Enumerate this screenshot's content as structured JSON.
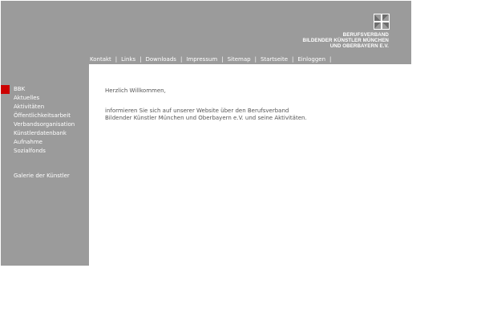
{
  "header": {
    "org_lines": [
      "BERUFSVERBAND",
      "BILDENDER KÜNSTLER MÜNCHEN",
      "UND OBERBAYERN E.V."
    ],
    "logo_icon": "bbk-logo-icon",
    "background_color": "#9b9b9b"
  },
  "topnav": {
    "items": [
      "Kontakt",
      "Links",
      "Downloads",
      "Impressum",
      "Sitemap",
      "Startseite",
      "Einloggen"
    ],
    "separator": "|"
  },
  "sidebar": {
    "items": [
      "BBK",
      "Aktuelles",
      "Aktivitäten",
      "Öffentlichkeitsarbeit",
      "Verbandsorganisation",
      "Künstlerdatenbank",
      "Aufnahme",
      "Sozialfonds"
    ],
    "active_index": 0,
    "active_color": "#cc0000",
    "extra_item": "Galerie der Künstler"
  },
  "main": {
    "greeting": "Herzlich Willkommen,",
    "intro_lines": [
      "informieren Sie sich auf unserer Website über den Berufsverband",
      "Bildender Künstler München und Oberbayern e.V. und seine Aktivitäten."
    ]
  }
}
